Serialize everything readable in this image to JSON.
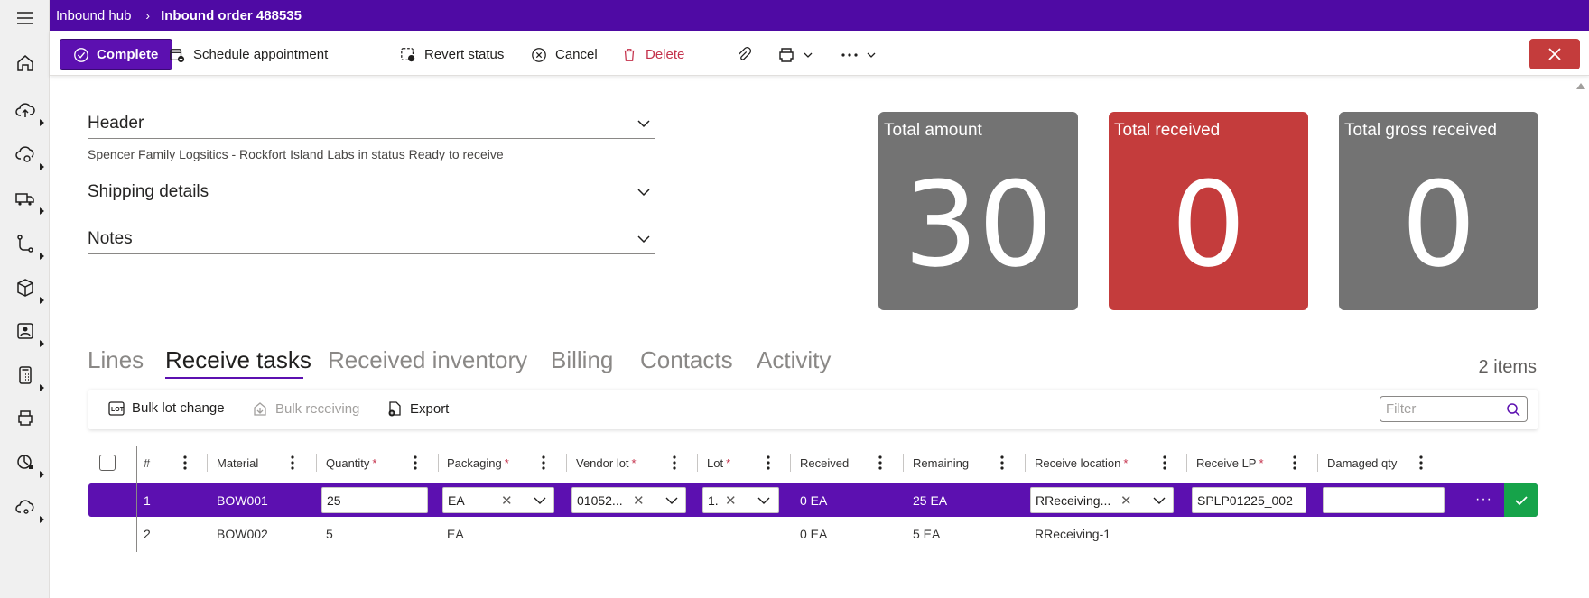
{
  "breadcrumb": {
    "hub": "Inbound hub",
    "sep": "›",
    "current": "Inbound order 488535"
  },
  "toolbar": {
    "complete": "Complete",
    "schedule": "Schedule appointment",
    "revert": "Revert status",
    "cancel": "Cancel",
    "delete": "Delete"
  },
  "sections": {
    "header": "Header",
    "header_sub": "Spencer Family Logsitics - Rockfort Island Labs in status Ready to receive",
    "shipping": "Shipping details",
    "notes": "Notes"
  },
  "tiles": [
    {
      "label": "Total amount",
      "value": "30",
      "color": "#737373"
    },
    {
      "label": "Total received",
      "value": "0",
      "color": "#c43c3c"
    },
    {
      "label": "Total gross received",
      "value": "0",
      "color": "#737373"
    }
  ],
  "tabs": {
    "lines": "Lines",
    "receive_tasks": "Receive tasks",
    "received_inventory": "Received inventory",
    "billing": "Billing",
    "contacts": "Contacts",
    "activity": "Activity",
    "active": "Receive tasks",
    "count": "2 items"
  },
  "grid_toolbar": {
    "bulk_lot": "Bulk lot change",
    "bulk_receiving": "Bulk receiving",
    "export": "Export",
    "filter_placeholder": "Filter"
  },
  "columns": {
    "num": "#",
    "material": "Material",
    "quantity": "Quantity",
    "packaging": "Packaging",
    "vendor_lot": "Vendor lot",
    "lot": "Lot",
    "received": "Received",
    "remaining": "Remaining",
    "receive_location": "Receive location",
    "receive_lp": "Receive LP",
    "damaged_qty": "Damaged qty",
    "required_mark": "*"
  },
  "rows": [
    {
      "num": "1",
      "material": "BOW001",
      "quantity": "25",
      "packaging": "EA",
      "vendor_lot": "01052...",
      "lot": "1.",
      "received": "0 EA",
      "remaining": "25 EA",
      "receive_location": "RReceiving...",
      "receive_lp": "SPLP01225_002",
      "damaged_qty": ""
    },
    {
      "num": "2",
      "material": "BOW002",
      "quantity": "5",
      "packaging": "EA",
      "vendor_lot": "",
      "lot": "",
      "received": "0 EA",
      "remaining": "5 EA",
      "receive_location": "RReceiving-1",
      "receive_lp": "",
      "damaged_qty": ""
    }
  ],
  "colors": {
    "brand": "#4f0aa4",
    "selected_row": "#5c10b0",
    "danger": "#c43c3c",
    "success": "#16a34a"
  }
}
